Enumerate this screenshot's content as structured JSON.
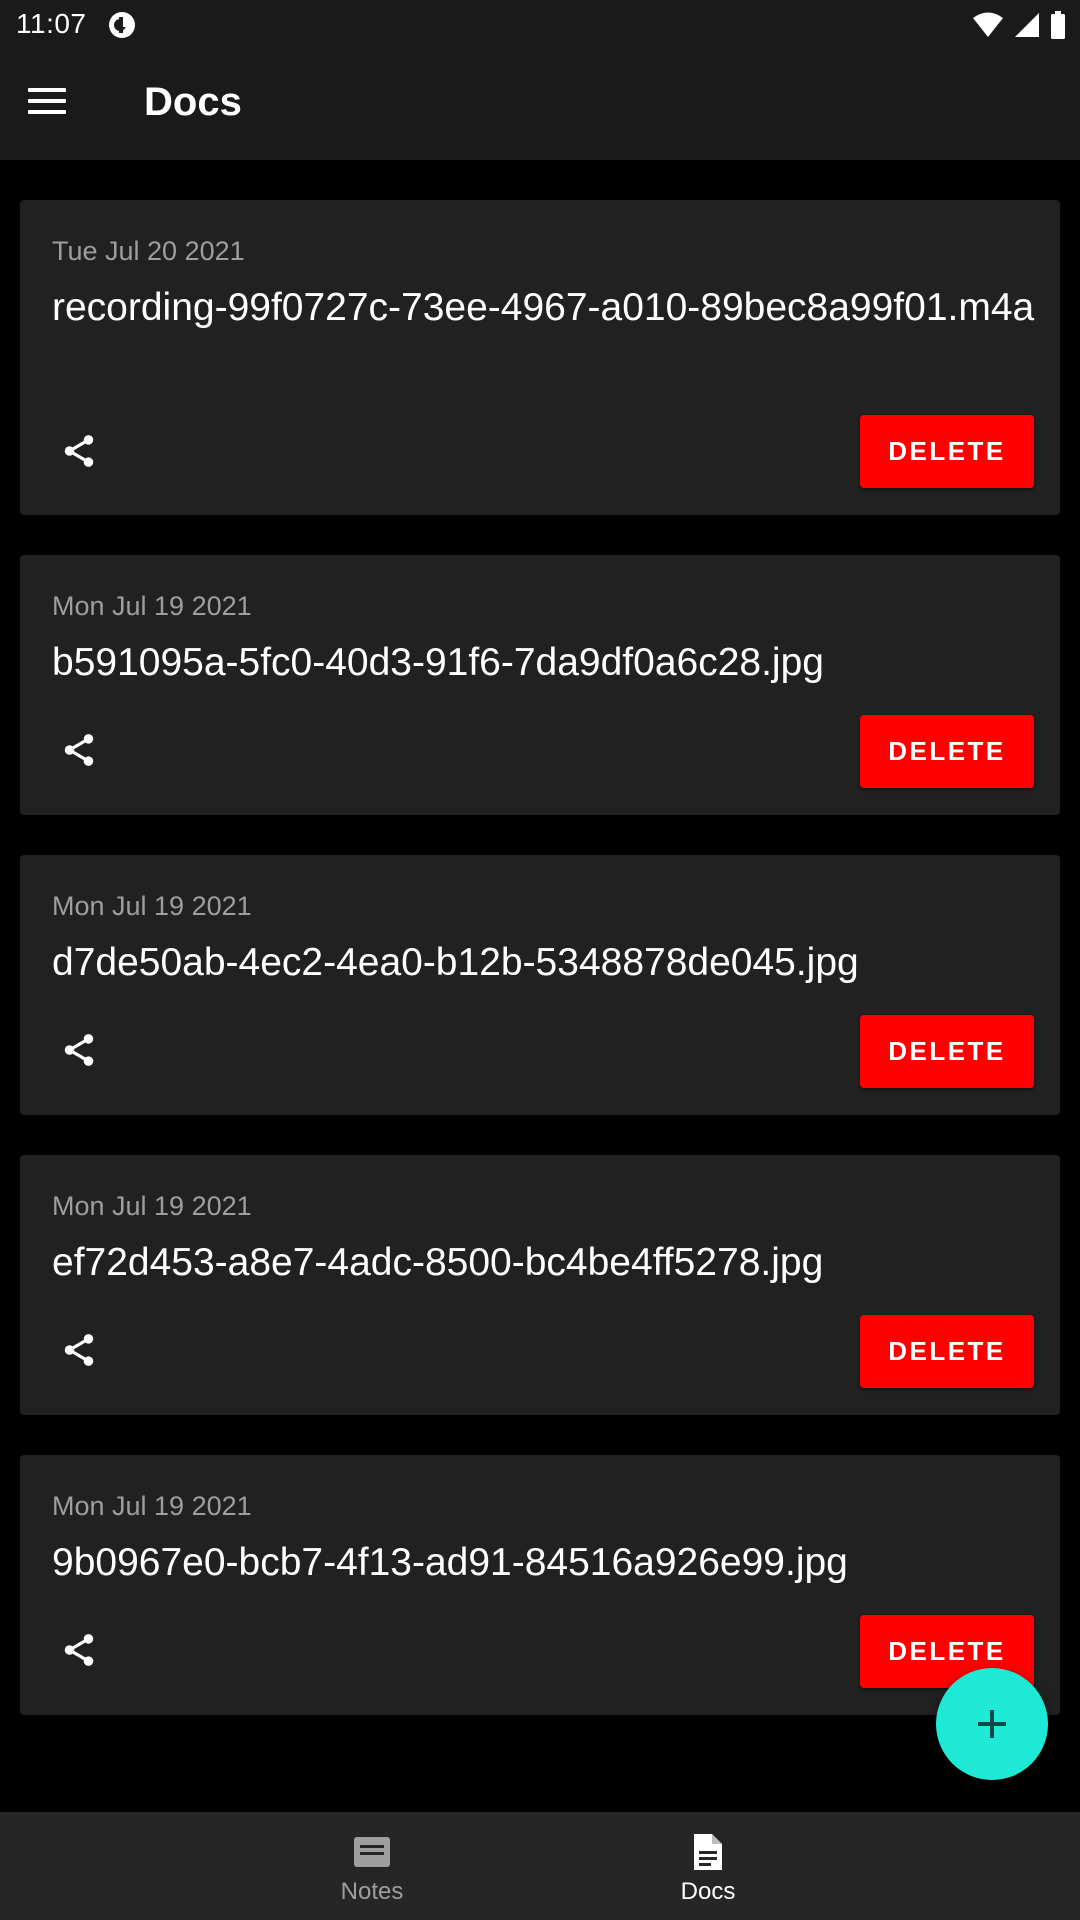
{
  "status_bar": {
    "time": "11:07"
  },
  "app_bar": {
    "title": "Docs"
  },
  "docs": [
    {
      "date": "Tue Jul 20 2021",
      "name": "recording-99f0727c-73ee-4967-a010-89bec8a99f01.m4a",
      "delete_label": "DELETE"
    },
    {
      "date": "Mon Jul 19 2021",
      "name": "b591095a-5fc0-40d3-91f6-7da9df0a6c28.jpg",
      "delete_label": "DELETE"
    },
    {
      "date": "Mon Jul 19 2021",
      "name": "d7de50ab-4ec2-4ea0-b12b-5348878de045.jpg",
      "delete_label": "DELETE"
    },
    {
      "date": "Mon Jul 19 2021",
      "name": "ef72d453-a8e7-4adc-8500-bc4be4ff5278.jpg",
      "delete_label": "DELETE"
    },
    {
      "date": "Mon Jul 19 2021",
      "name": "9b0967e0-bcb7-4f13-ad91-84516a926e99.jpg",
      "delete_label": "DELETE"
    }
  ],
  "bottom_nav": {
    "items": [
      {
        "label": "Notes",
        "icon": "notes-icon",
        "active": false
      },
      {
        "label": "Docs",
        "icon": "docs-icon",
        "active": true
      }
    ]
  },
  "colors": {
    "background": "#000000",
    "surface": "#212121",
    "bar": "#1a1a1a",
    "delete": "#ff0000",
    "fab": "#1de9d6",
    "nav_active": "#ffffff",
    "nav_inactive": "#9e9e9e"
  },
  "icons": {
    "menu": "hamburger-menu-icon",
    "share": "share-icon",
    "fab": "plus-icon",
    "wifi": "wifi-icon",
    "signal": "signal-icon",
    "battery": "battery-icon"
  }
}
